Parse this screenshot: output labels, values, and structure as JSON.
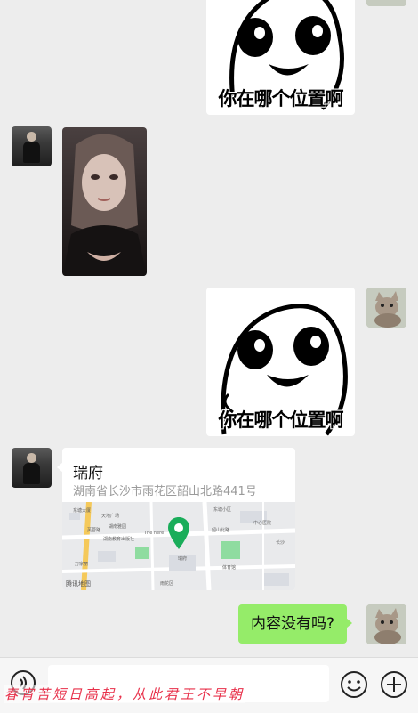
{
  "messages": {
    "sticker_top_caption": "你在哪个位置啊",
    "sticker_mid_caption": "你在哪个位置啊",
    "location": {
      "title": "瑞府",
      "address": "湖南省长沙市雨花区韶山北路441号",
      "map_provider": "腾讯地图",
      "map_labels": [
        "东塘大厦",
        "天地广场",
        "芙蓉路",
        "湖南雅园",
        "湖南教育出版社",
        "瑞府",
        "The here",
        "东塘小区",
        "韶山北路",
        "雨花区",
        "万家丽",
        "体育馆",
        "中心医院",
        "长沙"
      ]
    },
    "text_reply": "内容没有吗?"
  },
  "input_bar": {
    "placeholder": ""
  },
  "overlay": {
    "text": "春宵苦短日高起，从此君王不早朝"
  },
  "colors": {
    "chat_background": "#ededed",
    "sent_bubble": "#95ec69",
    "map_pin": "#1aad5a"
  }
}
